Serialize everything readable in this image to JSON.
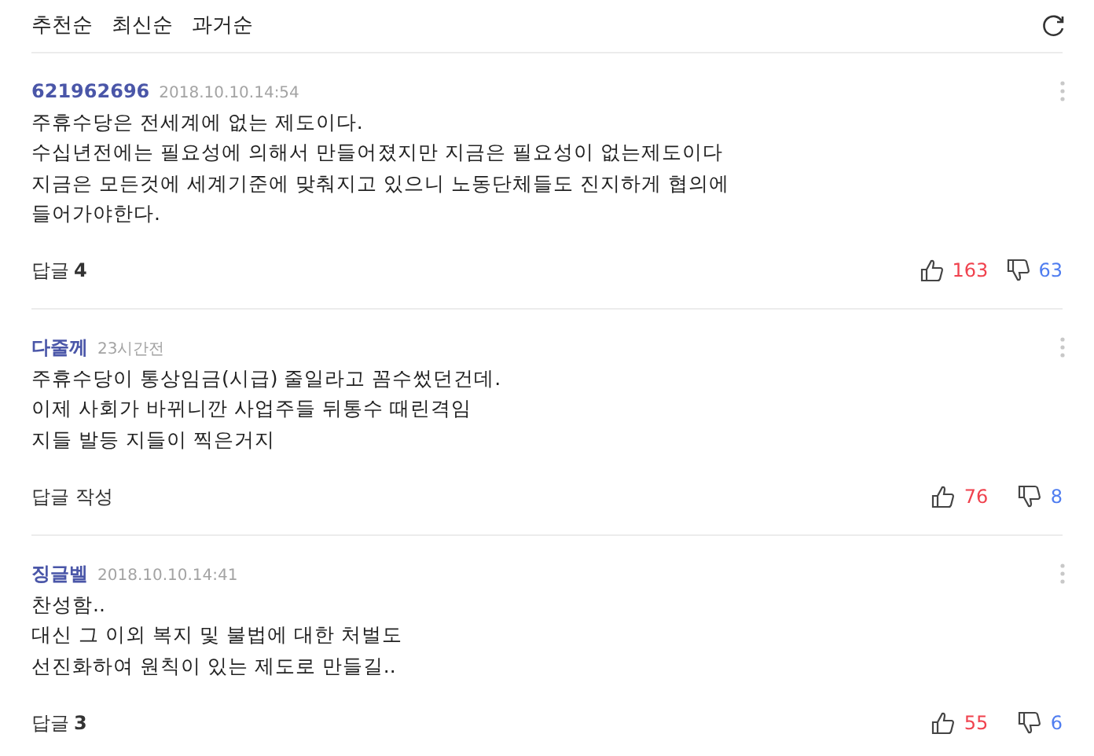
{
  "sort_tabs": [
    {
      "label": "추천순"
    },
    {
      "label": "최신순"
    },
    {
      "label": "과거순"
    }
  ],
  "comments": [
    {
      "author": "621962696",
      "time": "2018.10.10.14:54",
      "lines": [
        "주휴수당은 전세계에 없는 제도이다.",
        "수십년전에는 필요성에 의해서 만들어졌지만 지금은 필요성이 없는제도이다",
        "지금은 모든것에 세계기준에 맞춰지고 있으니 노동단체들도 진지하게 협의에",
        "들어가야한다."
      ],
      "reply_label": "답글",
      "reply_count": "4",
      "likes": "163",
      "dislikes": "63"
    },
    {
      "author": "다줄께",
      "time": "23시간전",
      "lines": [
        "주휴수당이 통상임금(시급) 줄일라고 꼼수썼던건데.",
        "이제 사회가 바뀌니깐 사업주들 뒤통수 때린격임",
        "지들 발등 지들이 찍은거지"
      ],
      "reply_label": "답글 작성",
      "likes": "76",
      "dislikes": "8"
    },
    {
      "author": "징글벨",
      "time": "2018.10.10.14:41",
      "lines": [
        "찬성함..",
        "대신 그 이외 복지 및 불법에 대한 처벌도",
        "선진화하여 원칙이 있는 제도로 만들길.."
      ],
      "reply_label": "답글",
      "reply_count": "3",
      "likes": "55",
      "dislikes": "6"
    }
  ]
}
